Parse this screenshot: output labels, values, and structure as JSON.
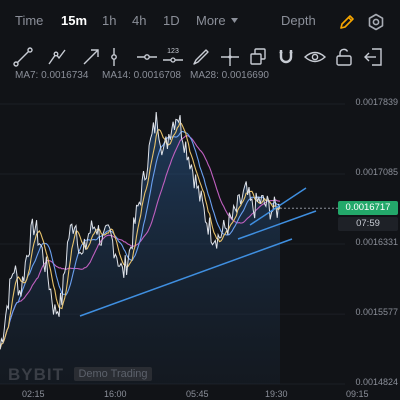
{
  "header": {
    "tabs": [
      {
        "label": "Time"
      },
      {
        "label": "15m",
        "active": true
      },
      {
        "label": "1h"
      },
      {
        "label": "4h"
      },
      {
        "label": "1D"
      },
      {
        "label": "More"
      }
    ],
    "depth_label": "Depth",
    "icons": [
      "chevron-down-icon",
      "pencil-icon",
      "settings-icon"
    ],
    "accent_color": "#f7a600"
  },
  "drawing_tools": [
    "trend-line",
    "ray",
    "arrow",
    "vertical-line",
    "horizontal-line",
    "price-range",
    "brush",
    "crosshair",
    "layers",
    "magnet",
    "visibility",
    "lock",
    "exit"
  ],
  "ma_legend": [
    {
      "label": "MA7: 0.0016734",
      "color": "#e8c26a"
    },
    {
      "label": "MA14: 0.0016708",
      "color": "#6aa0f0"
    },
    {
      "label": "MA28: 0.0016690",
      "color": "#c060c0"
    }
  ],
  "price_axis": [
    "0.0017839",
    "0.0017085",
    "0.0016331",
    "0.0015577",
    "0.0014824"
  ],
  "time_axis": [
    "02:15",
    "16:00",
    "05:45",
    "19:30",
    "09:15"
  ],
  "current_price": "0.0016717",
  "candle_countdown": "07:59",
  "watermark": {
    "brand": "BYBIT",
    "badge": "Demo Trading"
  },
  "chart_data": {
    "type": "line",
    "interval": "15m",
    "y_range": [
      0.0014824,
      0.0017839
    ],
    "series": [
      {
        "name": "MA7",
        "color": "#e8c26a"
      },
      {
        "name": "MA14",
        "color": "#6aa0f0"
      },
      {
        "name": "MA28",
        "color": "#c060c0"
      }
    ],
    "price_path": [
      0.00152,
      0.001565,
      0.00161,
      0.00158,
      0.001625,
      0.001655,
      0.00163,
      0.0016,
      0.00156,
      0.00157,
      0.00164,
      0.00166,
      0.001615,
      0.001645,
      0.001655,
      0.001635,
      0.001645,
      0.001625,
      0.0016,
      0.001625,
      0.001665,
      0.0017,
      0.00174,
      0.00177,
      0.00173,
      0.00176,
      0.001775,
      0.001745,
      0.00172,
      0.00169,
      0.001665,
      0.001645,
      0.00164,
      0.00165,
      0.00166,
      0.001675,
      0.00169,
      0.00167,
      0.00168,
      0.001675,
      0.00167,
      0.0016717
    ],
    "current": 0.0016717,
    "trendlines": 2
  }
}
